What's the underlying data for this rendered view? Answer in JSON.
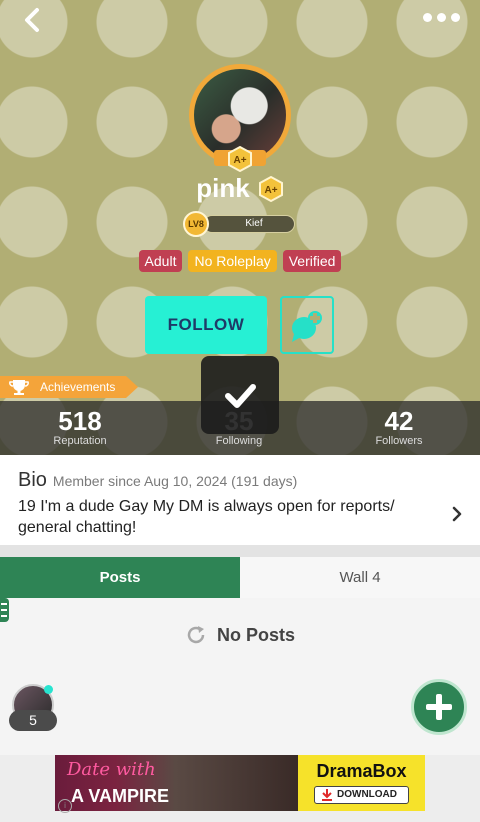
{
  "header": {
    "username": "pink",
    "level": "LV8",
    "level_title": "Kief",
    "tags": [
      {
        "label": "Adult",
        "color": "#c03f52"
      },
      {
        "label": "No Roleplay",
        "color": "#f2b31f"
      },
      {
        "label": "Verified",
        "color": "#c03f52"
      }
    ],
    "follow_label": "FOLLOW",
    "achievements_label": "Achievements"
  },
  "stats": {
    "reputation": {
      "value": "518",
      "label": "Reputation"
    },
    "following": {
      "value": "35",
      "label": "Following"
    },
    "followers": {
      "value": "42",
      "label": "Followers"
    }
  },
  "bio": {
    "title": "Bio",
    "member_since": "Member since Aug 10, 2024 (191 days)",
    "text": "19 I'm a dude Gay My DM is always open for reports/ general chatting!"
  },
  "tabs": {
    "posts": "Posts",
    "wall": "Wall 4"
  },
  "content": {
    "empty_label": "No Posts",
    "online_count": "5"
  },
  "ad": {
    "line1": "Date with",
    "line2": "A VAMPIRE",
    "brand": "DramaBox",
    "cta": "DOWNLOAD"
  },
  "colors": {
    "accent": "#26f0d4",
    "tab_active": "#2e8455",
    "header_bg": "#b1ae74",
    "gold": "#f2b834"
  },
  "icons": [
    "back-arrow-icon",
    "more-dots-icon",
    "badge-icon",
    "chat-add-icon",
    "trophy-icon",
    "checkmark-icon",
    "chevron-right-icon",
    "refresh-icon",
    "plus-icon",
    "download-icon"
  ]
}
